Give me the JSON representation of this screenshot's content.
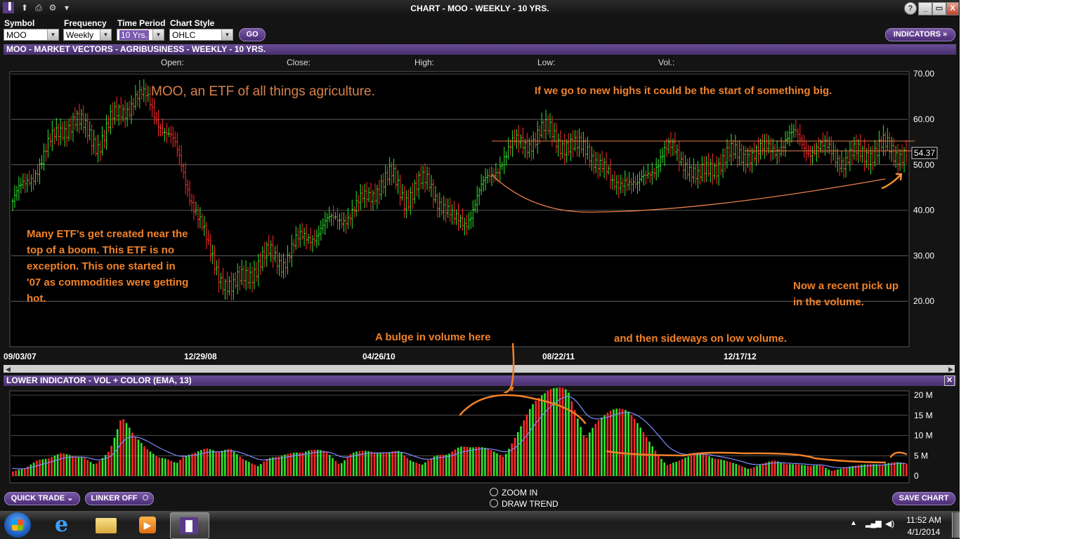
{
  "window": {
    "title": "CHART - MOO - WEEKLY - 10 YRS.",
    "help": "?",
    "minimize": "_",
    "restore": "▭",
    "close": "X"
  },
  "toolbar": {
    "symbol_label": "Symbol",
    "symbol_value": "MOO",
    "frequency_label": "Frequency",
    "frequency_value": "Weekly",
    "period_label": "Time Period",
    "period_value": "10 Yrs.",
    "style_label": "Chart Style",
    "style_value": "OHLC",
    "go_label": "GO",
    "indicators_label": "INDICATORS »"
  },
  "price_panel": {
    "header": "MOO - MARKET VECTORS - AGRIBUSINESS - WEEKLY - 10 YRS.",
    "open_label": "Open:",
    "close_label": "Close:",
    "high_label": "High:",
    "low_label": "Low:",
    "vol_label": "Vol.:",
    "last_price": "54.37",
    "annotations": {
      "title": "MOO, an ETF of all things agriculture.",
      "new_highs": "If we go to new highs it could be the start of something big.",
      "boom_1": "Many ETF's get created near the",
      "boom_2": "top of a boom. This ETF is no",
      "boom_3": "exception. This one started in",
      "boom_4": "'07 as commodities were getting",
      "boom_5": "hot.",
      "pickup_1": "Now a recent pick up",
      "pickup_2": "in the volume.",
      "bulge": "A bulge in volume here",
      "sideways": "and then sideways on low volume."
    }
  },
  "volume_panel": {
    "header": "LOWER INDICATOR - VOL + COLOR (EMA, 13)"
  },
  "bottom_bar": {
    "quick_trade": "QUICK TRADE ⌄",
    "linker": "LINKER OFF",
    "zoom_in": "ZOOM IN",
    "draw_trend": "DRAW TREND",
    "save_chart": "SAVE CHART"
  },
  "taskbar": {
    "time": "11:52 AM",
    "date": "4/1/2014"
  },
  "chart_data": [
    {
      "type": "ohlc",
      "frequency": "weekly",
      "y_axis": {
        "min": 20,
        "max": 70,
        "ticks": [
          "20.00",
          "30.00",
          "40.00",
          "50.00",
          "60.00",
          "70.00"
        ]
      },
      "x_tick_labels": [
        "09/03/07",
        "12/29/08",
        "04/26/10",
        "08/22/11",
        "12/17/12"
      ],
      "grid": true,
      "last_close": 54.37,
      "closes": [
        42,
        45,
        50,
        54,
        58,
        60,
        57,
        55,
        59,
        62,
        65,
        64,
        60,
        55,
        48,
        40,
        31,
        26,
        22,
        26,
        28,
        30,
        29,
        32,
        34,
        36,
        37,
        39,
        40,
        43,
        46,
        47,
        43,
        45,
        46,
        42,
        37,
        38,
        43,
        47,
        52,
        54,
        55,
        57,
        57,
        55,
        53,
        54,
        50,
        45,
        48,
        44,
        49,
        52,
        53,
        51,
        46,
        50,
        51,
        52,
        53,
        52,
        54,
        55,
        56,
        54,
        53,
        53,
        51,
        52,
        53,
        54,
        52,
        54
      ]
    },
    {
      "type": "bar",
      "series_label": "VOL + COLOR (EMA, 13)",
      "y_axis": {
        "min": 0,
        "max": 20,
        "unit": "M",
        "ticks": [
          "0",
          "5 M",
          "10 M",
          "15 M",
          "20 M"
        ]
      },
      "volume_m": [
        2,
        2,
        3,
        3,
        4,
        4,
        5,
        5,
        6,
        11,
        7,
        5,
        4,
        5,
        6,
        5,
        5,
        4,
        5,
        4,
        4,
        5,
        4,
        4,
        4,
        5,
        6,
        5,
        6,
        5,
        4,
        4,
        5,
        4,
        5,
        5,
        4,
        5,
        5,
        6,
        7,
        9,
        11,
        13,
        14,
        16,
        19,
        17,
        15,
        13,
        12,
        11,
        9,
        7,
        5,
        4,
        4,
        4,
        3,
        3,
        3,
        3,
        3,
        3,
        2,
        2,
        2,
        3,
        2,
        2,
        2,
        2,
        2,
        3,
        4
      ]
    }
  ]
}
